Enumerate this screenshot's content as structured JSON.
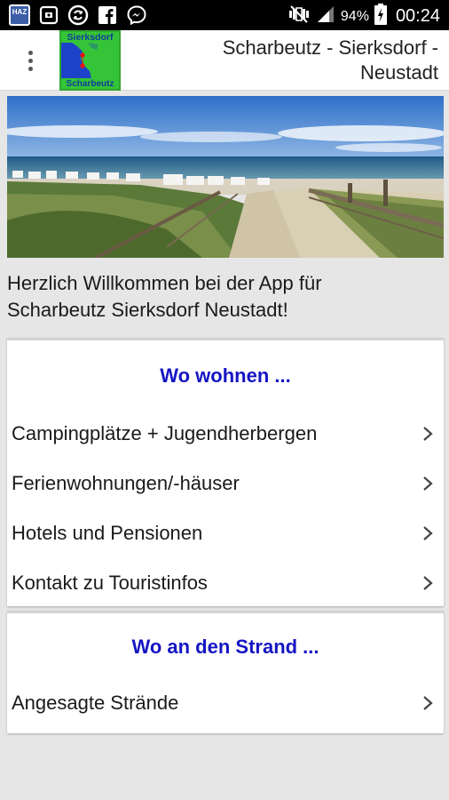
{
  "status_bar": {
    "notification_icons": [
      "haz-app-icon",
      "screenshot-icon",
      "sync-icon",
      "facebook-icon",
      "messenger-icon"
    ],
    "haz_label": "HAZ",
    "battery_percent": "94%",
    "time": "00:24"
  },
  "app_bar": {
    "logo_top": "Sierksdorf",
    "logo_bottom": "Scharbeutz",
    "title_line1": "Scharbeutz - Sierksdorf -",
    "title_line2": "Neustadt"
  },
  "welcome": {
    "line1": "Herzlich Willkommen bei der App für",
    "line2": "Scharbeutz Sierksdorf Neustadt!"
  },
  "sections": [
    {
      "header": "Wo wohnen ...",
      "items": [
        {
          "label": "Campingplätze + Jugendherbergen"
        },
        {
          "label": "Ferienwohnungen/-häuser"
        },
        {
          "label": "Hotels und Pensionen"
        },
        {
          "label": "Kontakt zu Touristinfos"
        }
      ]
    },
    {
      "header": "Wo an den Strand ...",
      "items": [
        {
          "label": "Angesagte Strände"
        }
      ]
    }
  ],
  "colors": {
    "section_header": "#1515c4",
    "logo_green": "#35c437",
    "status_bar": "#000000"
  }
}
